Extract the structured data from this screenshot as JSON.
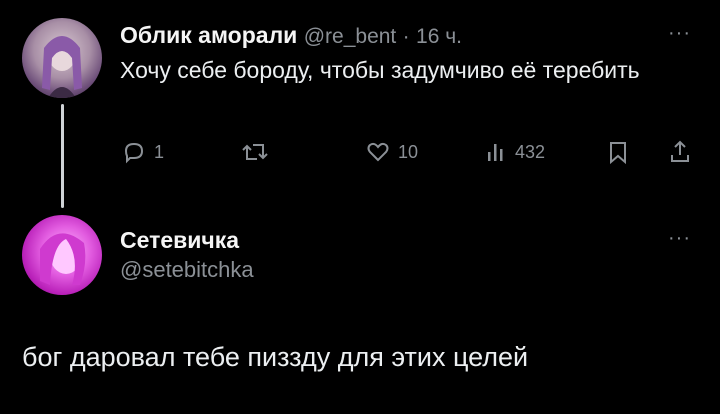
{
  "tweet": {
    "author_name": "Облик аморали",
    "author_handle": "@re_bent",
    "separator": "·",
    "time": "16 ч.",
    "text": "Хочу себе бороду, чтобы задумчиво её теребить",
    "more": "···",
    "actions": {
      "replies": "1",
      "retweets": "",
      "likes": "10",
      "views": "432"
    },
    "icons": [
      "reply-icon",
      "retweet-icon",
      "like-icon",
      "views-icon",
      "bookmark-icon",
      "share-icon"
    ]
  },
  "reply": {
    "author_name": "Сетевичка",
    "author_handle": "@setebitchka",
    "more": "···",
    "text": "бог даровал тебе пиззду для этих целей"
  }
}
